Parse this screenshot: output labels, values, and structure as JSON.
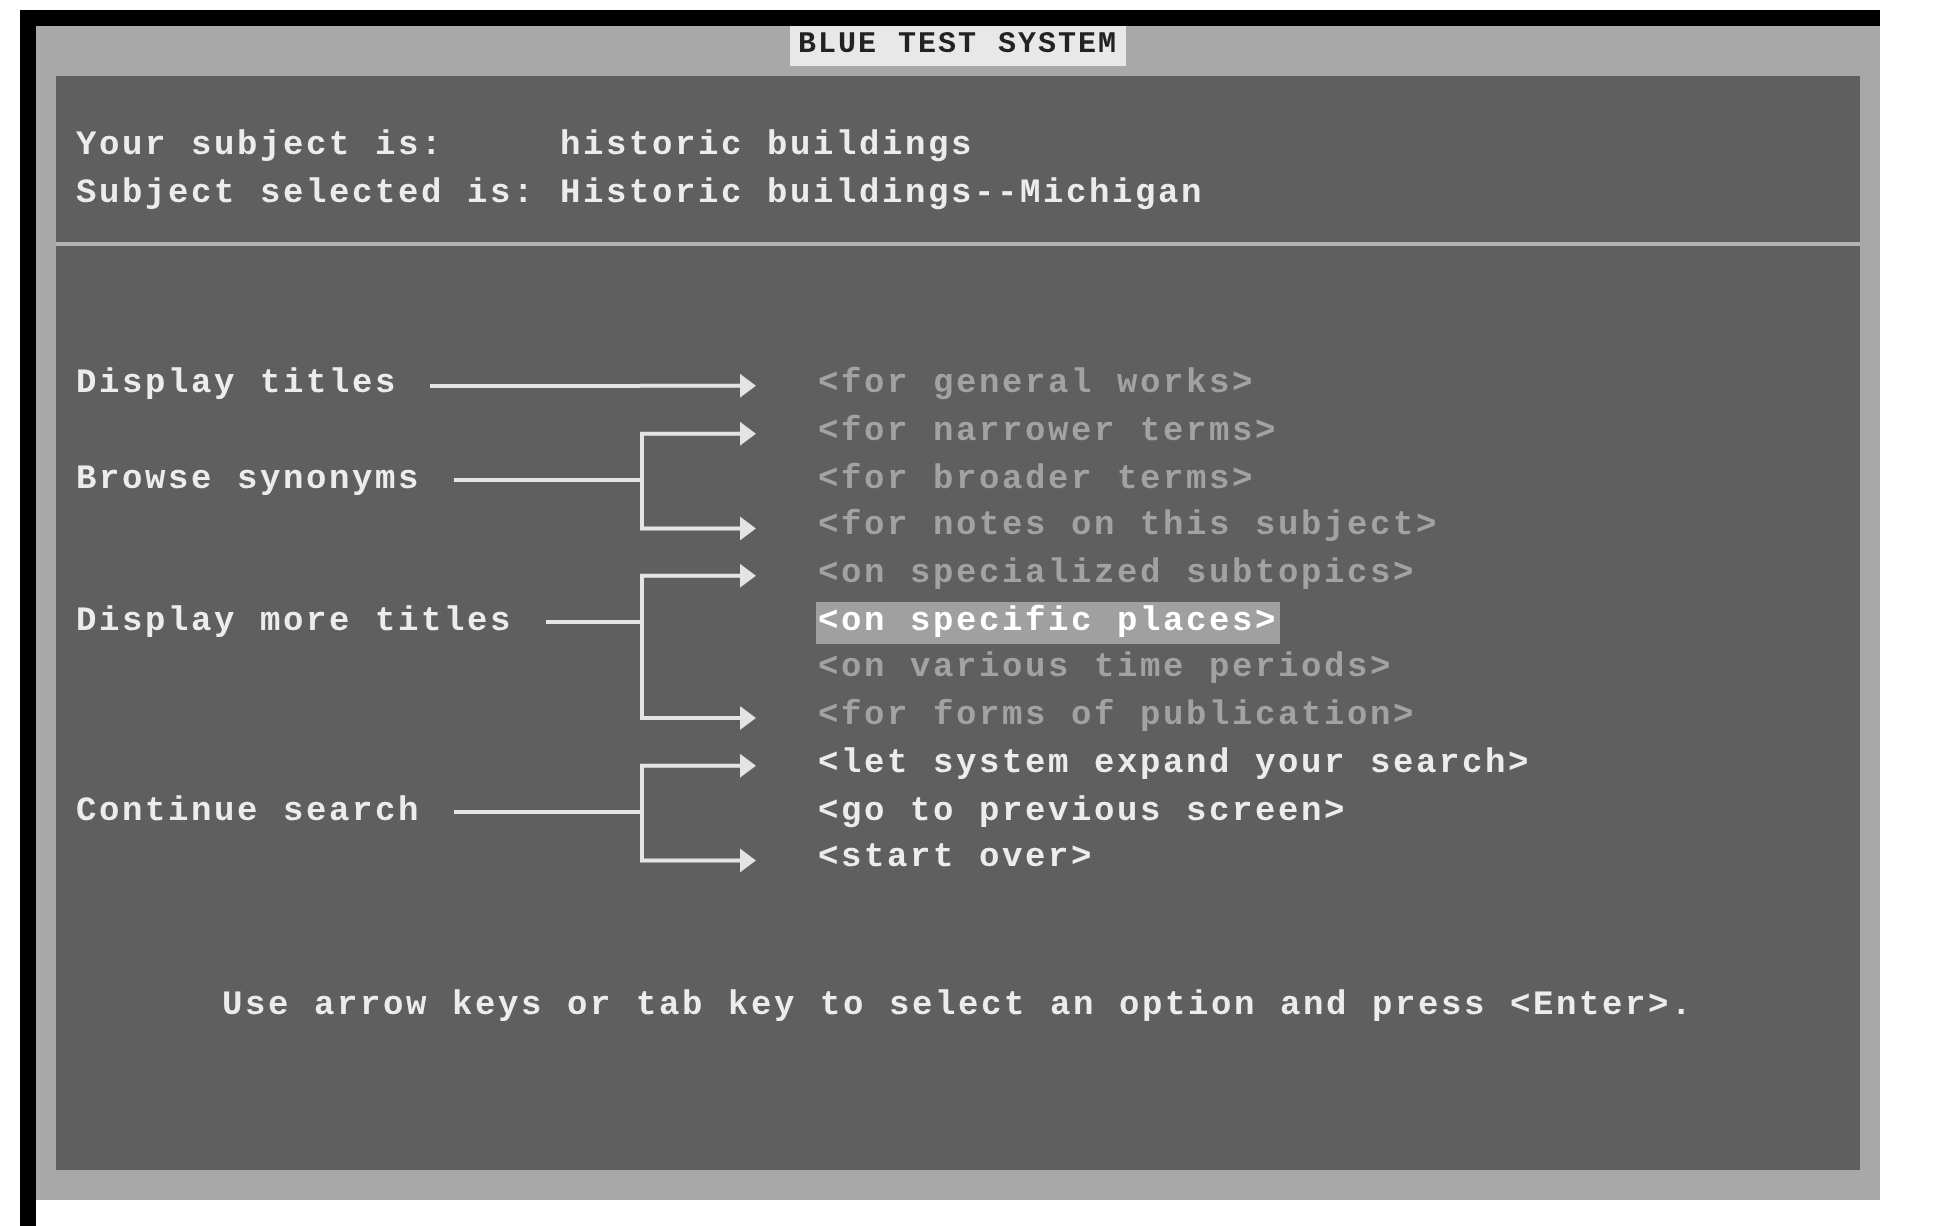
{
  "window": {
    "title": "BLUE TEST SYSTEM"
  },
  "subject": [
    {
      "label": "Your subject is:",
      "value": "historic buildings"
    },
    {
      "label": "Subject selected is:",
      "value": "Historic buildings--Michigan"
    }
  ],
  "groups": [
    {
      "label": "Display titles",
      "options": [
        {
          "text": "<for general works>",
          "disabled": true,
          "selected": false
        }
      ]
    },
    {
      "label": "Browse synonyms",
      "options": [
        {
          "text": "<for narrower terms>",
          "disabled": true,
          "selected": false
        },
        {
          "text": "<for broader terms>",
          "disabled": true,
          "selected": false
        },
        {
          "text": "<for notes on this subject>",
          "disabled": true,
          "selected": false
        }
      ]
    },
    {
      "label": "Display more titles",
      "options": [
        {
          "text": "<on specialized subtopics>",
          "disabled": true,
          "selected": false
        },
        {
          "text": "<on specific places>",
          "disabled": false,
          "selected": true
        },
        {
          "text": "<on various time periods>",
          "disabled": true,
          "selected": false
        },
        {
          "text": "<for forms of publication>",
          "disabled": true,
          "selected": false
        }
      ]
    },
    {
      "label": "Continue search",
      "options": [
        {
          "text": "<let system expand your search>",
          "disabled": false,
          "selected": false
        },
        {
          "text": "<go to previous screen>",
          "disabled": false,
          "selected": false
        },
        {
          "text": "<start over>",
          "disabled": false,
          "selected": false
        }
      ]
    }
  ],
  "instruction": "Use arrow keys or tab key to select an option and press <Enter>."
}
